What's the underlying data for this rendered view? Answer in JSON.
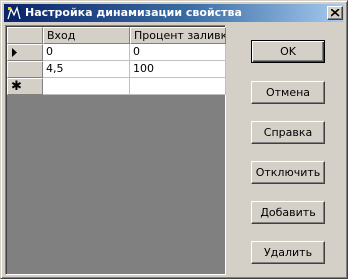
{
  "window": {
    "title": "Настройка динамизации свойства"
  },
  "grid": {
    "columns": [
      "Вход",
      "Процент заливки"
    ],
    "rows": [
      [
        "0",
        "0"
      ],
      [
        "4,5",
        "100"
      ]
    ],
    "new_row_marker": "✱"
  },
  "buttons": {
    "ok": "OK",
    "cancel": "Отмена",
    "help": "Справка",
    "disable": "Отключить",
    "add": "Добавить",
    "delete": "Удалить"
  },
  "colors": {
    "title_active_start": "#0a246a",
    "title_active_end": "#a6caf0",
    "face": "#d4d0c8"
  }
}
